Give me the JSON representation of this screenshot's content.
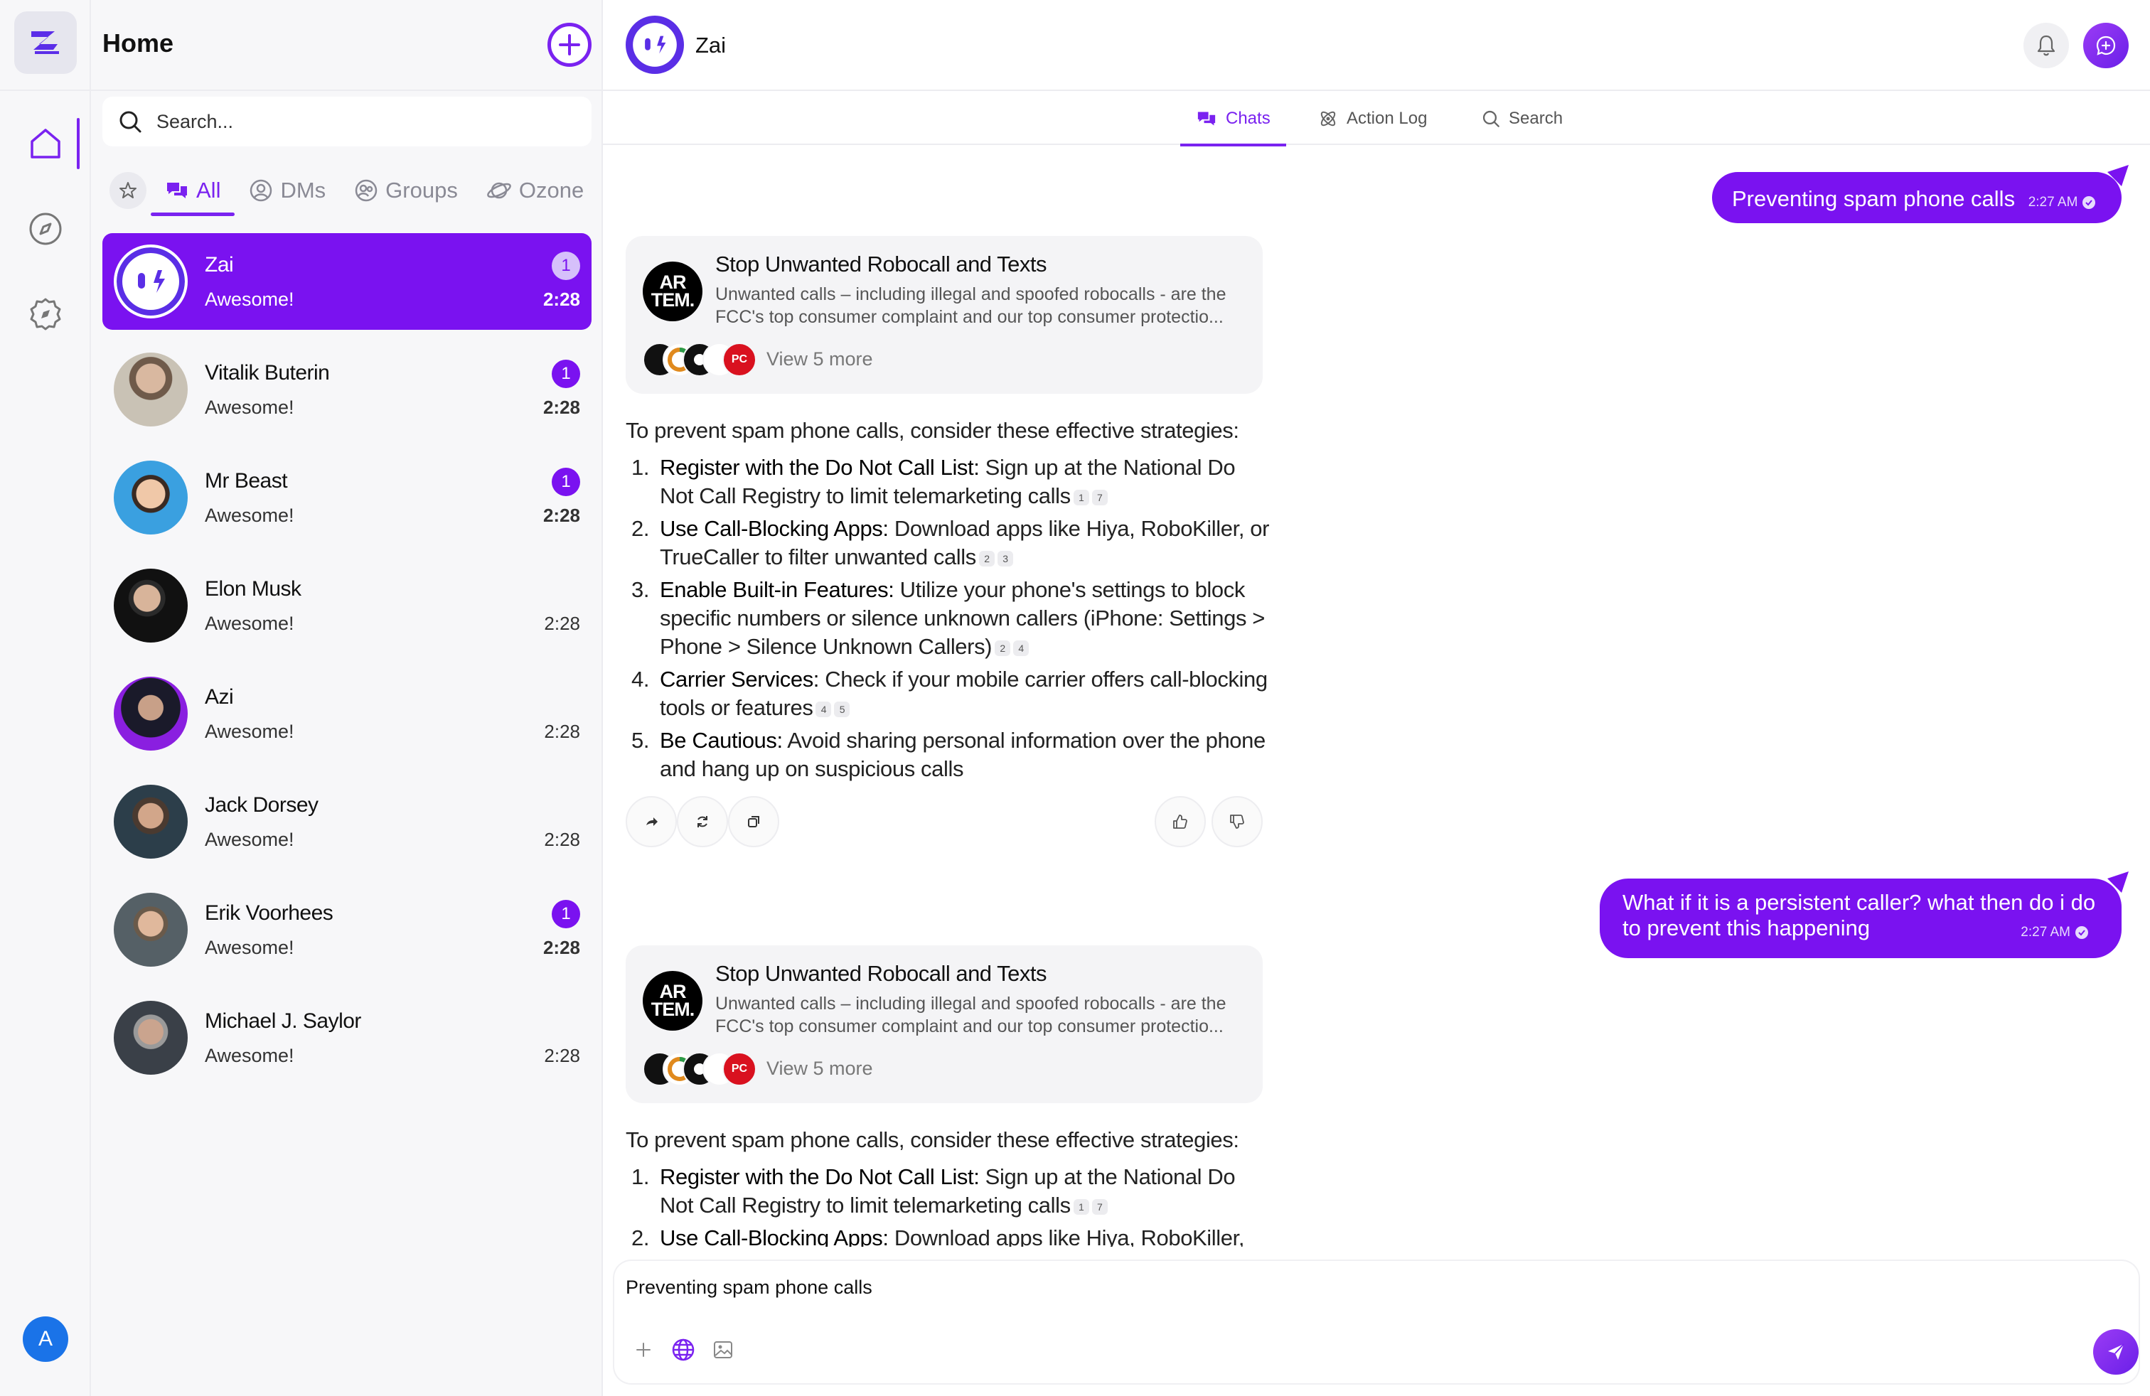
{
  "sidebar": {
    "items": [
      {
        "name": "home"
      },
      {
        "name": "discover"
      },
      {
        "name": "explore"
      }
    ],
    "user_initial": "A"
  },
  "panel": {
    "title": "Home",
    "search_placeholder": "Search...",
    "filters": [
      "All",
      "DMs",
      "Groups",
      "Ozone"
    ],
    "chats": [
      {
        "name": "Zai",
        "preview": "Awesome!",
        "time": "2:28",
        "badge": "1",
        "active": true
      },
      {
        "name": "Vitalik Buterin",
        "preview": "Awesome!",
        "time": "2:28",
        "badge": "1"
      },
      {
        "name": "Mr Beast",
        "preview": "Awesome!",
        "time": "2:28",
        "badge": "1"
      },
      {
        "name": "Elon Musk",
        "preview": "Awesome!",
        "time": "2:28",
        "badge": ""
      },
      {
        "name": "Azi",
        "preview": "Awesome!",
        "time": "2:28",
        "badge": ""
      },
      {
        "name": "Jack Dorsey",
        "preview": "Awesome!",
        "time": "2:28",
        "badge": ""
      },
      {
        "name": "Erik Voorhees",
        "preview": "Awesome!",
        "time": "2:28",
        "badge": "1"
      },
      {
        "name": "Michael J. Saylor",
        "preview": "Awesome!",
        "time": "2:28",
        "badge": ""
      }
    ]
  },
  "header": {
    "title": "Zai"
  },
  "tabs": [
    "Chats",
    "Action Log",
    "Search"
  ],
  "messages": [
    {
      "user": {
        "text": "Preventing spam phone calls",
        "time": "2:27 AM"
      },
      "source": {
        "logo": "AR TEM.",
        "title": "Stop Unwanted Robocall and Texts",
        "desc": "Unwanted calls – including illegal and spoofed robocalls - are the FCC's top consumer complaint and our top consumer protectio...",
        "more": "View 5 more"
      },
      "answer": {
        "intro": "To prevent spam phone calls, consider these effective strategies:",
        "items": [
          {
            "n": "1.",
            "title": "Register with the Do Not Call List:",
            "text": " Sign up at the National Do Not Call Registry to limit telemarketing calls",
            "cites": [
              "1",
              "7"
            ]
          },
          {
            "n": "2.",
            "title": "Use Call-Blocking Apps:",
            "text": " Download apps like Hiya, RoboKiller, or TrueCaller to filter unwanted calls",
            "cites": [
              "2",
              "3"
            ]
          },
          {
            "n": "3.",
            "title": "Enable Built-in Features:",
            "text": " Utilize your phone's settings to block specific numbers or silence unknown callers (iPhone: Settings > Phone > Silence Unknown Callers)",
            "cites": [
              "2",
              "4"
            ]
          },
          {
            "n": "4.",
            "title": "Carrier Services:",
            "text": " Check if your mobile carrier offers call-blocking tools or features",
            "cites": [
              "4",
              "5"
            ]
          },
          {
            "n": "5.",
            "title": "Be Cautious:",
            "text": " Avoid sharing personal information over the phone and hang up on suspicious calls",
            "cites": []
          }
        ]
      }
    },
    {
      "user": {
        "text": "What if it is a persistent caller? what then do i do to prevent this happening",
        "time": "2:27 AM"
      },
      "source": {
        "logo": "AR TEM.",
        "title": "Stop Unwanted Robocall and Texts",
        "desc": "Unwanted calls – including illegal and spoofed robocalls - are the FCC's top consumer complaint and our top consumer protectio...",
        "more": "View 5 more"
      },
      "answer": {
        "intro": "To prevent spam phone calls, consider these effective strategies:",
        "items": [
          {
            "n": "1.",
            "title": "Register with the Do Not Call List:",
            "text": " Sign up at the National Do Not Call Registry to limit telemarketing calls",
            "cites": [
              "1",
              "7"
            ]
          },
          {
            "n": "2.",
            "title": "Use Call-Blocking Apps:",
            "text": " Download apps like Hiya, RoboKiller,",
            "cites": []
          }
        ]
      }
    }
  ],
  "composer": {
    "value": "Preventing spam phone calls"
  },
  "colors": {
    "accent": "#7a12f0",
    "panel_bg": "#f7f7f9"
  }
}
